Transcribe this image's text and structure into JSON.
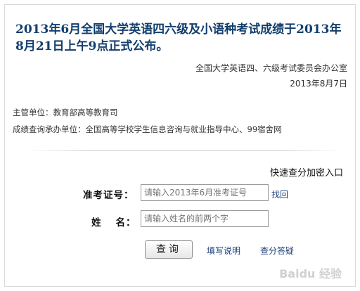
{
  "notice": {
    "headline": "2013年6月全国大学英语四六级及小语种考试成绩于2013年8月21日上午9点正式公布。",
    "issuer": "全国大学英语四、六级考试委员会办公室",
    "date": "2013年8月7日",
    "supervisor": "主管单位：教育部高等教育司",
    "undertaker": "成绩查询承办单位：全国高等学校学生信息咨询与就业指导中心、99宿舍网"
  },
  "form": {
    "quick_link": "快速查分加密入口",
    "ticket_label": "准考证号：",
    "ticket_placeholder": "请输入2013年6月准考证号",
    "retrieve_label": "找回",
    "name_label_first": "姓",
    "name_label_second": "名：",
    "name_placeholder": "请输入姓名的前两个字",
    "submit_label": "查询",
    "help_link": "填写说明",
    "answers_link": "查分答疑"
  },
  "watermark": {
    "text": "Baidu 经验"
  }
}
